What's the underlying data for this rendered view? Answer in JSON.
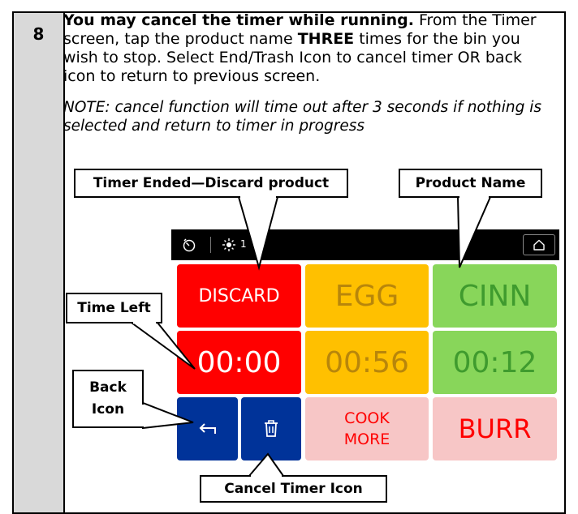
{
  "step": {
    "number": "8",
    "instruction_bold": "You may cancel the timer while running.",
    "instruction_part1": " From the Timer screen, tap the product name ",
    "instruction_emph": "THREE",
    "instruction_part2": " times for the bin you wish to stop. Select End/Trash Icon to cancel timer OR back icon to return to previous screen.",
    "note": "NOTE: cancel function will time out after 3 seconds if nothing is selected and return to timer in progress"
  },
  "callouts": {
    "timer_ended": "Timer Ended—Discard product",
    "product_name": "Product Name",
    "time_left": "Time Left",
    "back_icon_line1": "Back",
    "back_icon_line2": "Icon",
    "cancel_timer_icon": "Cancel Timer Icon"
  },
  "screen": {
    "status_icons": [
      "timer-icon",
      "brightness-icon",
      "home-icon"
    ],
    "status_value": "1",
    "tiles": {
      "discard": "DISCARD",
      "egg": "EGG",
      "cinn": "CINN",
      "time_discard": "00:00",
      "time_egg": "00:56",
      "time_cinn": "00:12",
      "cook_more_line1": "COOK",
      "cook_more_line2": "MORE",
      "burr": "BURR"
    },
    "colors": {
      "red": "#ff0000",
      "amber": "#ffc000",
      "amber_text": "#b8860b",
      "green": "#88d65a",
      "green_text": "#3f9b2e",
      "blue": "#003399",
      "pink": "#f7c6c6"
    }
  }
}
